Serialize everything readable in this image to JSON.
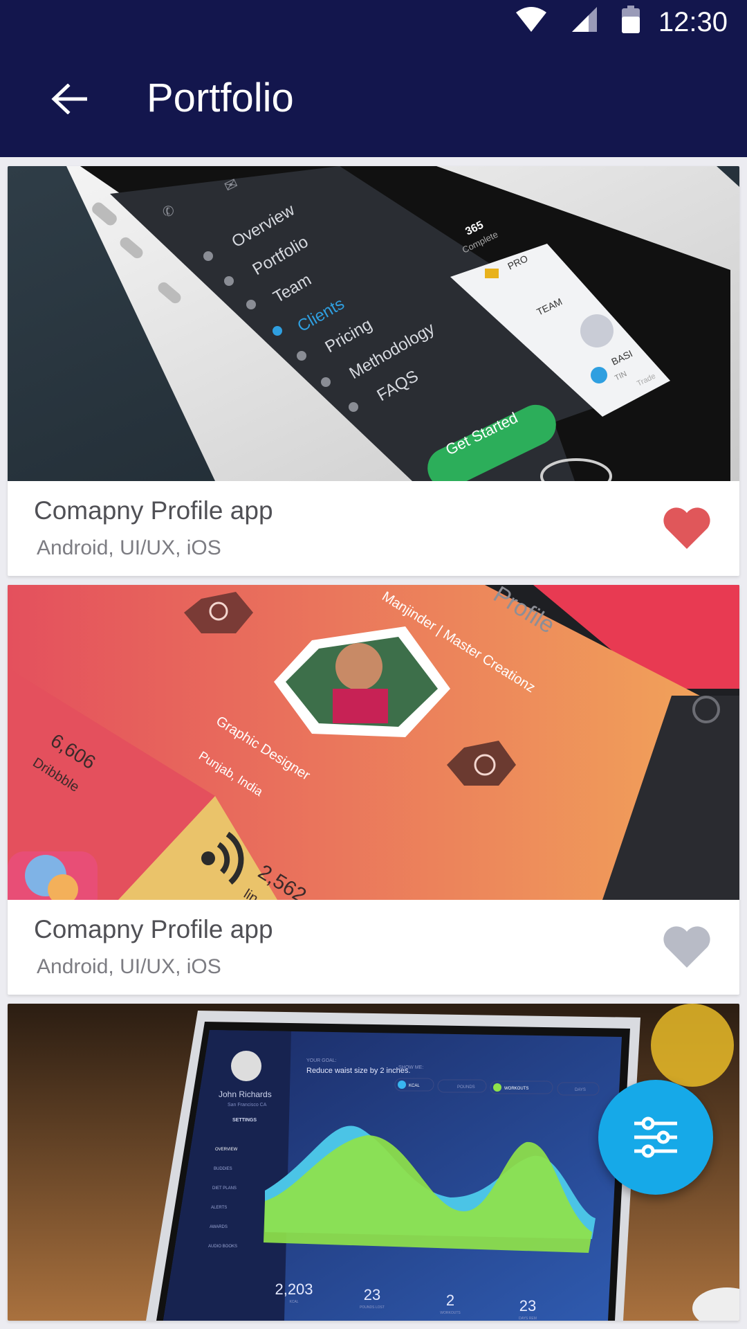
{
  "status_bar": {
    "time": "12:30",
    "icons": [
      "wifi-icon",
      "signal-icon",
      "battery-icon"
    ]
  },
  "app_bar": {
    "title": "Portfolio",
    "back_icon": "arrow-back-icon"
  },
  "colors": {
    "primary": "#13164d",
    "accent": "#16a9e8",
    "favorite_active": "#e0575a",
    "favorite_inactive": "#b8bbc6"
  },
  "cards": [
    {
      "title": "Comapny Profile app",
      "subtitle": "Android, UI/UX, iOS",
      "favorited": true,
      "mockup": {
        "menu_items": [
          "Overview",
          "Portfolio",
          "Team",
          "Clients",
          "Pricing",
          "Methodology",
          "FAQS"
        ],
        "cta": "Get Started",
        "stat": "365",
        "stat_label": "Complete",
        "side_labels": [
          "PRO",
          "TEAM",
          "BASI",
          "TIN",
          "Trade"
        ]
      }
    },
    {
      "title": "Comapny Profile app",
      "subtitle": "Android, UI/UX, iOS",
      "favorited": false,
      "mockup": {
        "header": "Profile",
        "name": "Manjinder | Master Creationz",
        "role": "Graphic Designer",
        "location": "Punjab, India",
        "stat1": "6,606",
        "stat1_label": "Dribbble",
        "stat2": "2,562",
        "stat2_label": "lin"
      }
    },
    {
      "mockup": {
        "user": "John Richards",
        "location": "San Francisco CA",
        "settings": "SETTINGS",
        "goal_label": "YOUR GOAL:",
        "goal": "Reduce waist size by 2 inches.",
        "show_label": "SHOW ME:",
        "filters": [
          "KCAL",
          "POUNDS",
          "WORKOUTS",
          "DAYS"
        ],
        "nav": [
          "OVERVIEW",
          "BUDDIES",
          "DIET PLANS",
          "ALERTS",
          "AWARDS",
          "AUDIO BOOKS"
        ],
        "stats": [
          {
            "value": "2,203",
            "label": "KCAL"
          },
          {
            "value": "23",
            "label": "POUNDS LOST"
          },
          {
            "value": "2",
            "label": "WORKOUTS"
          },
          {
            "value": "23",
            "label": "DAYS REM"
          }
        ]
      }
    }
  ],
  "fab": {
    "icon": "filter-sliders-icon"
  }
}
